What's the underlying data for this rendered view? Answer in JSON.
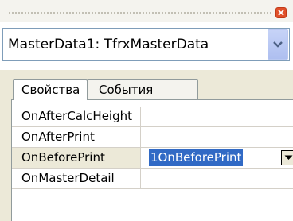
{
  "object_selector": {
    "value": "MasterData1: TfrxMasterData"
  },
  "tabs": [
    {
      "label": "Свойства",
      "active": true
    },
    {
      "label": "События",
      "active": false
    }
  ],
  "events": [
    {
      "name": "OnAfterCalcHeight",
      "value": ""
    },
    {
      "name": "OnAfterPrint",
      "value": ""
    },
    {
      "name": "OnBeforePrint",
      "value": "1OnBeforePrint",
      "selected": true
    },
    {
      "name": "OnMasterDetail",
      "value": ""
    }
  ],
  "colors": {
    "selection": "#316ac5",
    "panel": "#ece9d8",
    "close_button": "#e0502a"
  },
  "icons": [
    "grip-handle",
    "close-icon",
    "chevron-down-icon",
    "dropdown-arrow-icon"
  ]
}
